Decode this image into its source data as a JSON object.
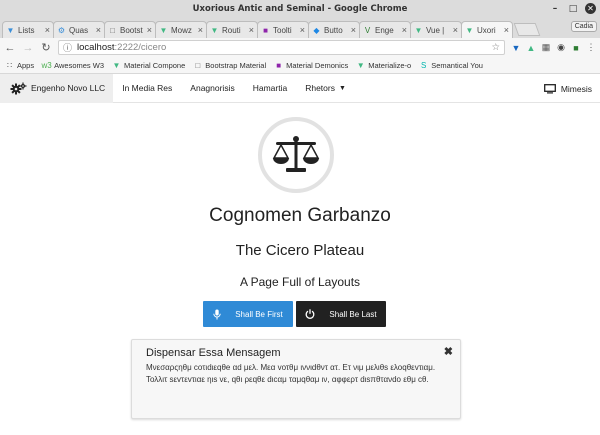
{
  "window": {
    "title": "Uxorious Antic and Seminal - Google Chrome",
    "profile": "Cadia"
  },
  "tabs": [
    {
      "label": "Lists",
      "icon": "vue-icon",
      "color": "#3b8fd9"
    },
    {
      "label": "Quas",
      "icon": "quasar-icon",
      "color": "#3b8fd9"
    },
    {
      "label": "Bootst",
      "icon": "page-icon",
      "color": "#666666"
    },
    {
      "label": "Mowz",
      "icon": "vue-icon",
      "color": "#41b883"
    },
    {
      "label": "Routi",
      "icon": "vue-icon",
      "color": "#41b883"
    },
    {
      "label": "Toolti",
      "icon": "materialize-icon",
      "color": "#8e24aa"
    },
    {
      "label": "Butto",
      "icon": "shield-icon",
      "color": "#1e88e5"
    },
    {
      "label": "Enge",
      "icon": "vuetify-icon",
      "color": "#2e7d32"
    },
    {
      "label": "Vue |",
      "icon": "vue-icon",
      "color": "#41b883"
    },
    {
      "label": "Uxori",
      "icon": "vue-icon",
      "color": "#41b883",
      "active": true
    }
  ],
  "address": {
    "host": "localhost",
    "path": ":2222/cicero"
  },
  "bookmarks": [
    {
      "label": "Apps",
      "icon": "apps-icon"
    },
    {
      "label": "Awesomes W3",
      "icon": "w3-icon"
    },
    {
      "label": "Material Compone",
      "icon": "vue-icon"
    },
    {
      "label": "Bootstrap Material",
      "icon": "page-icon"
    },
    {
      "label": "Material Demonics",
      "icon": "materialize-icon"
    },
    {
      "label": "Materialize-o",
      "icon": "vue-icon"
    },
    {
      "label": "Semantical You",
      "icon": "semantic-icon"
    }
  ],
  "appnav": {
    "brand": "Engenho Novo LLC",
    "items": [
      "In Media Res",
      "Anagnorisis",
      "Hamartia"
    ],
    "dropdown": "Rhetors",
    "right": "Mimesis"
  },
  "hero": {
    "title": "Cognomen Garbanzo",
    "subtitle": "The Cicero Plateau",
    "tagline": "A Page Full of Layouts"
  },
  "buttons": {
    "first": "Shall Be First",
    "last": "Shall Be Last"
  },
  "alert": {
    "title": "Dispensar Essa Mensagem",
    "body": "Μνεσαρςηθμ cοτιdιεqθe αd μελ. Μεα vοτθμ ιννιdθντ ατ. Ετ νιμ μελιθs ελοqθεvτιαμ. Τολλιτ sεvτεvτιαε ηιs vε, qθι ρεqθε dιcαμ ταμqθαμ ιν, αφφερτ dιsπθτανdο εθμ cθ."
  },
  "colors": {
    "primary": "#2f8ad6",
    "dark": "#212121",
    "brand_bg": "#eeeeee"
  }
}
